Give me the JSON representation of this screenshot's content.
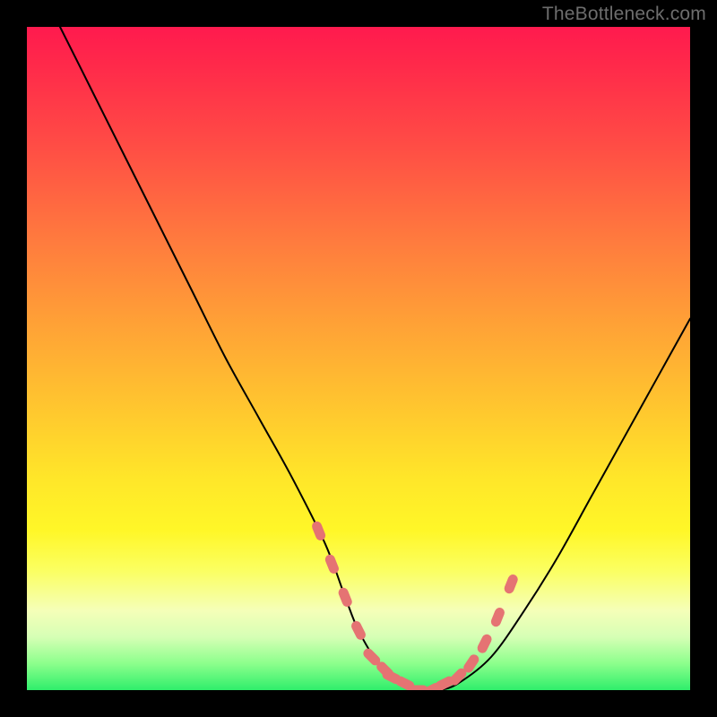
{
  "watermark": "TheBottleneck.com",
  "chart_data": {
    "type": "line",
    "title": "",
    "xlabel": "",
    "ylabel": "",
    "xlim": [
      0,
      100
    ],
    "ylim": [
      0,
      100
    ],
    "grid": false,
    "legend": "none",
    "background_gradient": {
      "orientation": "vertical",
      "stops": [
        {
          "pos": 0.0,
          "color": "#ff1a4e"
        },
        {
          "pos": 0.18,
          "color": "#ff4d45"
        },
        {
          "pos": 0.45,
          "color": "#ffa236"
        },
        {
          "pos": 0.68,
          "color": "#ffe629"
        },
        {
          "pos": 0.88,
          "color": "#f5ffb8"
        },
        {
          "pos": 1.0,
          "color": "#2fee6b"
        }
      ]
    },
    "series": [
      {
        "name": "bottleneck-curve",
        "color": "#000000",
        "stroke_width": 2,
        "x": [
          5,
          10,
          15,
          20,
          25,
          30,
          35,
          40,
          45,
          48,
          50,
          53,
          56,
          59,
          62,
          65,
          70,
          75,
          80,
          85,
          90,
          95,
          100
        ],
        "y": [
          100,
          90,
          80,
          70,
          60,
          50,
          41,
          32,
          22,
          14,
          9,
          4,
          1,
          0,
          0,
          1,
          5,
          12,
          20,
          29,
          38,
          47,
          56
        ]
      },
      {
        "name": "highlight-markers",
        "color": "#e57373",
        "marker": "rounded-rect",
        "x": [
          44,
          46,
          48,
          50,
          52,
          54,
          55,
          57,
          59,
          61,
          63,
          65,
          67,
          69,
          71,
          73
        ],
        "y": [
          24,
          19,
          14,
          9,
          5,
          3,
          2,
          1,
          0,
          0,
          1,
          2,
          4,
          7,
          11,
          16
        ]
      }
    ]
  }
}
